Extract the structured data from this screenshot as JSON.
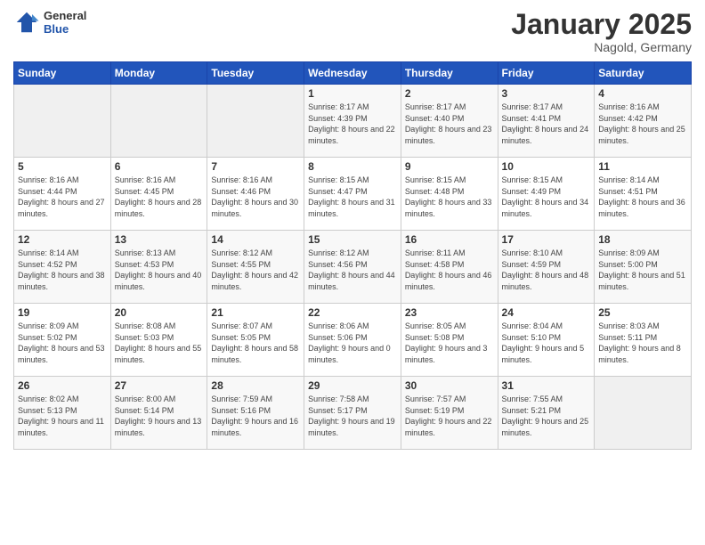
{
  "header": {
    "logo_general": "General",
    "logo_blue": "Blue",
    "title": "January 2025",
    "subtitle": "Nagold, Germany"
  },
  "columns": [
    "Sunday",
    "Monday",
    "Tuesday",
    "Wednesday",
    "Thursday",
    "Friday",
    "Saturday"
  ],
  "weeks": [
    [
      {
        "day": "",
        "sunrise": "",
        "sunset": "",
        "daylight": ""
      },
      {
        "day": "",
        "sunrise": "",
        "sunset": "",
        "daylight": ""
      },
      {
        "day": "",
        "sunrise": "",
        "sunset": "",
        "daylight": ""
      },
      {
        "day": "1",
        "sunrise": "Sunrise: 8:17 AM",
        "sunset": "Sunset: 4:39 PM",
        "daylight": "Daylight: 8 hours and 22 minutes."
      },
      {
        "day": "2",
        "sunrise": "Sunrise: 8:17 AM",
        "sunset": "Sunset: 4:40 PM",
        "daylight": "Daylight: 8 hours and 23 minutes."
      },
      {
        "day": "3",
        "sunrise": "Sunrise: 8:17 AM",
        "sunset": "Sunset: 4:41 PM",
        "daylight": "Daylight: 8 hours and 24 minutes."
      },
      {
        "day": "4",
        "sunrise": "Sunrise: 8:16 AM",
        "sunset": "Sunset: 4:42 PM",
        "daylight": "Daylight: 8 hours and 25 minutes."
      }
    ],
    [
      {
        "day": "5",
        "sunrise": "Sunrise: 8:16 AM",
        "sunset": "Sunset: 4:44 PM",
        "daylight": "Daylight: 8 hours and 27 minutes."
      },
      {
        "day": "6",
        "sunrise": "Sunrise: 8:16 AM",
        "sunset": "Sunset: 4:45 PM",
        "daylight": "Daylight: 8 hours and 28 minutes."
      },
      {
        "day": "7",
        "sunrise": "Sunrise: 8:16 AM",
        "sunset": "Sunset: 4:46 PM",
        "daylight": "Daylight: 8 hours and 30 minutes."
      },
      {
        "day": "8",
        "sunrise": "Sunrise: 8:15 AM",
        "sunset": "Sunset: 4:47 PM",
        "daylight": "Daylight: 8 hours and 31 minutes."
      },
      {
        "day": "9",
        "sunrise": "Sunrise: 8:15 AM",
        "sunset": "Sunset: 4:48 PM",
        "daylight": "Daylight: 8 hours and 33 minutes."
      },
      {
        "day": "10",
        "sunrise": "Sunrise: 8:15 AM",
        "sunset": "Sunset: 4:49 PM",
        "daylight": "Daylight: 8 hours and 34 minutes."
      },
      {
        "day": "11",
        "sunrise": "Sunrise: 8:14 AM",
        "sunset": "Sunset: 4:51 PM",
        "daylight": "Daylight: 8 hours and 36 minutes."
      }
    ],
    [
      {
        "day": "12",
        "sunrise": "Sunrise: 8:14 AM",
        "sunset": "Sunset: 4:52 PM",
        "daylight": "Daylight: 8 hours and 38 minutes."
      },
      {
        "day": "13",
        "sunrise": "Sunrise: 8:13 AM",
        "sunset": "Sunset: 4:53 PM",
        "daylight": "Daylight: 8 hours and 40 minutes."
      },
      {
        "day": "14",
        "sunrise": "Sunrise: 8:12 AM",
        "sunset": "Sunset: 4:55 PM",
        "daylight": "Daylight: 8 hours and 42 minutes."
      },
      {
        "day": "15",
        "sunrise": "Sunrise: 8:12 AM",
        "sunset": "Sunset: 4:56 PM",
        "daylight": "Daylight: 8 hours and 44 minutes."
      },
      {
        "day": "16",
        "sunrise": "Sunrise: 8:11 AM",
        "sunset": "Sunset: 4:58 PM",
        "daylight": "Daylight: 8 hours and 46 minutes."
      },
      {
        "day": "17",
        "sunrise": "Sunrise: 8:10 AM",
        "sunset": "Sunset: 4:59 PM",
        "daylight": "Daylight: 8 hours and 48 minutes."
      },
      {
        "day": "18",
        "sunrise": "Sunrise: 8:09 AM",
        "sunset": "Sunset: 5:00 PM",
        "daylight": "Daylight: 8 hours and 51 minutes."
      }
    ],
    [
      {
        "day": "19",
        "sunrise": "Sunrise: 8:09 AM",
        "sunset": "Sunset: 5:02 PM",
        "daylight": "Daylight: 8 hours and 53 minutes."
      },
      {
        "day": "20",
        "sunrise": "Sunrise: 8:08 AM",
        "sunset": "Sunset: 5:03 PM",
        "daylight": "Daylight: 8 hours and 55 minutes."
      },
      {
        "day": "21",
        "sunrise": "Sunrise: 8:07 AM",
        "sunset": "Sunset: 5:05 PM",
        "daylight": "Daylight: 8 hours and 58 minutes."
      },
      {
        "day": "22",
        "sunrise": "Sunrise: 8:06 AM",
        "sunset": "Sunset: 5:06 PM",
        "daylight": "Daylight: 9 hours and 0 minutes."
      },
      {
        "day": "23",
        "sunrise": "Sunrise: 8:05 AM",
        "sunset": "Sunset: 5:08 PM",
        "daylight": "Daylight: 9 hours and 3 minutes."
      },
      {
        "day": "24",
        "sunrise": "Sunrise: 8:04 AM",
        "sunset": "Sunset: 5:10 PM",
        "daylight": "Daylight: 9 hours and 5 minutes."
      },
      {
        "day": "25",
        "sunrise": "Sunrise: 8:03 AM",
        "sunset": "Sunset: 5:11 PM",
        "daylight": "Daylight: 9 hours and 8 minutes."
      }
    ],
    [
      {
        "day": "26",
        "sunrise": "Sunrise: 8:02 AM",
        "sunset": "Sunset: 5:13 PM",
        "daylight": "Daylight: 9 hours and 11 minutes."
      },
      {
        "day": "27",
        "sunrise": "Sunrise: 8:00 AM",
        "sunset": "Sunset: 5:14 PM",
        "daylight": "Daylight: 9 hours and 13 minutes."
      },
      {
        "day": "28",
        "sunrise": "Sunrise: 7:59 AM",
        "sunset": "Sunset: 5:16 PM",
        "daylight": "Daylight: 9 hours and 16 minutes."
      },
      {
        "day": "29",
        "sunrise": "Sunrise: 7:58 AM",
        "sunset": "Sunset: 5:17 PM",
        "daylight": "Daylight: 9 hours and 19 minutes."
      },
      {
        "day": "30",
        "sunrise": "Sunrise: 7:57 AM",
        "sunset": "Sunset: 5:19 PM",
        "daylight": "Daylight: 9 hours and 22 minutes."
      },
      {
        "day": "31",
        "sunrise": "Sunrise: 7:55 AM",
        "sunset": "Sunset: 5:21 PM",
        "daylight": "Daylight: 9 hours and 25 minutes."
      },
      {
        "day": "",
        "sunrise": "",
        "sunset": "",
        "daylight": ""
      }
    ]
  ]
}
